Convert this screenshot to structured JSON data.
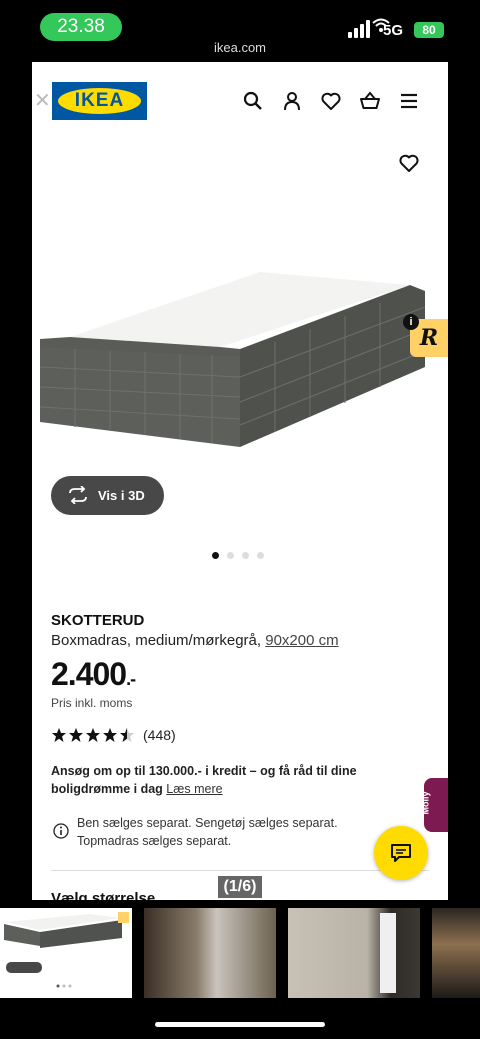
{
  "status_bar": {
    "time": "23.38",
    "url": "ikea.com",
    "network": "5G",
    "battery": "80"
  },
  "header": {
    "logo_text": "IKEA",
    "icons": [
      "close-icon",
      "search-icon",
      "account-icon",
      "heart-icon",
      "basket-icon",
      "menu-icon"
    ]
  },
  "gallery": {
    "view_3d_label": "Vis i 3D",
    "slide_count": 4,
    "active_slide": 1,
    "counter": "(1/6)"
  },
  "product": {
    "name": "SKOTTERUD",
    "description": "Boxmadras, medium/mørkegrå,",
    "size_link": "90x200 cm",
    "price": "2.400",
    "price_suffix": ".-",
    "price_note": "Pris inkl. moms",
    "rating": 4.5,
    "review_count": "(448)"
  },
  "credit": {
    "text": "Ansøg om op til 130.000.- i kredit – og få råd til dine boligdrømme i dag",
    "link": "Læs mere"
  },
  "notice": "Ben sælges separat. Sengetøj sælges separat. Topmadras sælges separat.",
  "next_section": "Vælg størrelse",
  "molly_tab": "Molly",
  "colors": {
    "ikea_blue": "#0058a3",
    "ikea_yellow": "#ffdb00",
    "status_green": "#34c759"
  }
}
